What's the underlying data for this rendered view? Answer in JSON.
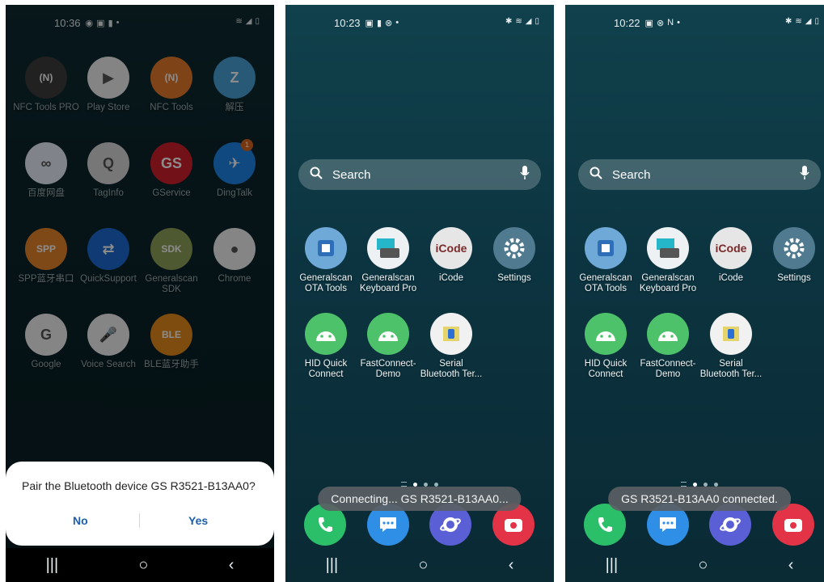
{
  "screen1": {
    "status": {
      "time": "10:36"
    },
    "apps": [
      {
        "label": "NFC Tools PRO",
        "icon": "nfc-pro-icon",
        "color": "#3c3c3c",
        "glyph": "(N)"
      },
      {
        "label": "Play Store",
        "icon": "play-store-icon",
        "color": "#f1f1f1",
        "glyph": "▶"
      },
      {
        "label": "NFC Tools",
        "icon": "nfc-tools-icon",
        "color": "#e87b2c",
        "glyph": "(N)"
      },
      {
        "label": "解压",
        "icon": "unzip-icon",
        "color": "#4aa3d8",
        "glyph": "Z"
      },
      {
        "label": "百度网盘",
        "icon": "baidu-netdisk-icon",
        "color": "#e9f1fb",
        "glyph": "∞"
      },
      {
        "label": "TagInfo",
        "icon": "taginfo-icon",
        "color": "#d9d9d9",
        "glyph": "Q"
      },
      {
        "label": "GService",
        "icon": "gservice-icon",
        "color": "#d0202d",
        "glyph": "GS"
      },
      {
        "label": "DingTalk",
        "icon": "dingtalk-icon",
        "color": "#1e86e8",
        "glyph": "✈"
      },
      {
        "label": "SPP蓝牙串口",
        "icon": "spp-icon",
        "color": "#e8862b",
        "glyph": "SPP"
      },
      {
        "label": "QuickSupport",
        "icon": "quicksupport-icon",
        "color": "#1d6ad1",
        "glyph": "⇄"
      },
      {
        "label": "Generalscan SDK",
        "icon": "generalscan-sdk-icon",
        "color": "#8ea05a",
        "glyph": "SDK"
      },
      {
        "label": "Chrome",
        "icon": "chrome-icon",
        "color": "#f2f2f2",
        "glyph": "●"
      },
      {
        "label": "Google",
        "icon": "google-icon",
        "color": "#f2f2f2",
        "glyph": "G"
      },
      {
        "label": "Voice Search",
        "icon": "voice-search-icon",
        "color": "#f2f2f2",
        "glyph": "🎤"
      },
      {
        "label": "BLE蓝牙助手",
        "icon": "ble-assistant-icon",
        "color": "#e68a1a",
        "glyph": "BLE"
      }
    ],
    "badge": "1",
    "dialog": {
      "message": "Pair the Bluetooth device GS R3521-B13AA0?",
      "no": "No",
      "yes": "Yes"
    }
  },
  "screen2": {
    "status": {
      "time": "10:23"
    },
    "search_placeholder": "Search",
    "toast": "Connecting... GS R3521-B13AA0..."
  },
  "screen3": {
    "status": {
      "time": "10:22"
    },
    "search_placeholder": "Search",
    "toast": "GS R3521-B13AA0 connected."
  },
  "home_apps": [
    {
      "label_line1": "Generalscan",
      "label_line2": "OTA Tools",
      "icon": "ota-tools-icon",
      "color": "#6fa9d8"
    },
    {
      "label_line1": "Generalscan",
      "label_line2": "Keyboard Pro",
      "icon": "keyboard-pro-icon",
      "color": "#eef1f3"
    },
    {
      "label_line1": "iCode",
      "label_line2": "",
      "icon": "icode-icon",
      "color": "#e6e6e6"
    },
    {
      "label_line1": "Settings",
      "label_line2": "",
      "icon": "settings-icon",
      "color": "#4f7a8f"
    },
    {
      "label_line1": "HID Quick",
      "label_line2": "Connect",
      "icon": "android-icon",
      "color": "#4dc26a"
    },
    {
      "label_line1": "FastConnect-",
      "label_line2": "Demo",
      "icon": "android-icon",
      "color": "#4dc26a"
    },
    {
      "label_line1": "Serial",
      "label_line2": "Bluetooth Ter...",
      "icon": "serial-bluetooth-icon",
      "color": "#f1f1f1"
    }
  ],
  "dock": [
    {
      "icon": "phone-icon",
      "color": "#2bbf6a"
    },
    {
      "icon": "messages-icon",
      "color": "#2f8fe6"
    },
    {
      "icon": "internet-icon",
      "color": "#5b5fd6"
    },
    {
      "icon": "camera-icon",
      "color": "#e33347"
    }
  ],
  "nav": {
    "recent": "|||",
    "home": "○",
    "back": "‹"
  }
}
